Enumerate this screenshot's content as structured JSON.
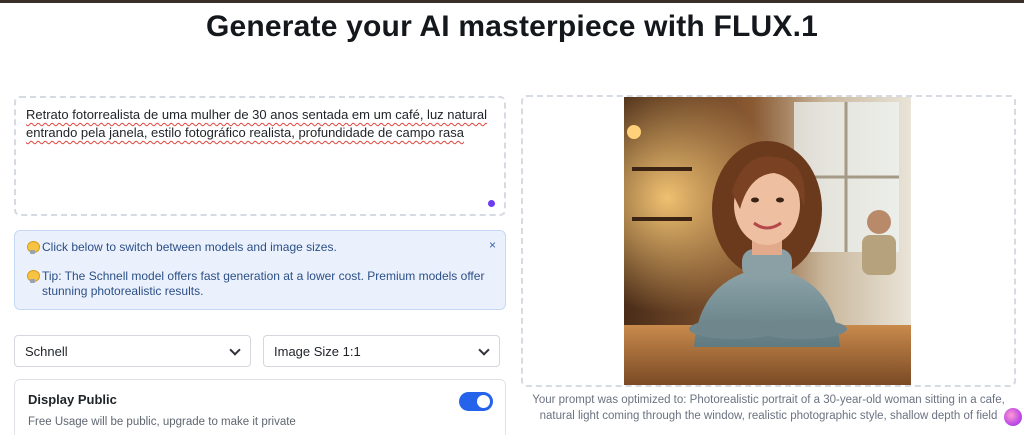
{
  "page": {
    "title": "Generate your AI masterpiece with FLUX.1"
  },
  "prompt": {
    "value": "Retrato fotorrealista de uma mulher de 30 anos sentada em um café, luz natural entrando pela janela, estilo fotográfico realista, profundidade de campo rasa"
  },
  "info": {
    "line1": "Click below to switch between models and image sizes.",
    "line2": "Tip: The Schnell model offers fast generation at a lower cost. Premium models offer stunning photorealistic results.",
    "close_label": "×"
  },
  "selects": {
    "model": "Schnell",
    "size": "Image Size 1:1"
  },
  "visibility": {
    "title": "Display Public",
    "subtitle": "Free Usage will be public, upgrade to make it private",
    "enabled": true
  },
  "result": {
    "optimized_text": "Your prompt was optimized to: Photorealistic portrait of a 30-year-old woman sitting in a cafe, natural light coming through the window, realistic photographic style, shallow depth of field",
    "image_icon": "generated-portrait"
  },
  "colors": {
    "accent": "#2563eb",
    "info_bg": "#eaf1fd",
    "prompt_dot": "#6b3cf2"
  }
}
